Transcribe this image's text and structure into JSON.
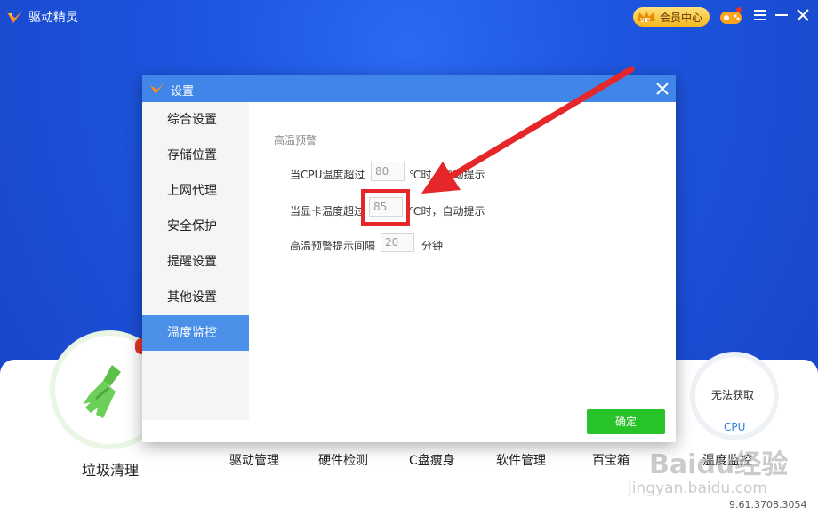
{
  "app": {
    "title": "驱动精灵",
    "vip_label": "会员中心",
    "version": "9.61.3708.3054"
  },
  "main": {
    "clean_label": "垃圾清理",
    "nav": [
      "驱动管理",
      "硬件检测",
      "C盘瘦身",
      "软件管理",
      "百宝箱",
      "温度监控"
    ],
    "cpu_status": "无法获取",
    "cpu_label": "CPU"
  },
  "dialog": {
    "title": "设置",
    "sidebar": [
      "综合设置",
      "存储位置",
      "上网代理",
      "安全保护",
      "提醒设置",
      "其他设置",
      "温度监控"
    ],
    "active_index": 6,
    "section_title": "高温预警",
    "rows": {
      "cpu_label_pre": "当CPU温度超过",
      "cpu_value": "80",
      "cpu_label_post": "℃时，自动提示",
      "gpu_label_pre": "当显卡温度超过",
      "gpu_value": "85",
      "gpu_label_post": "℃时，自动提示",
      "interval_label_pre": "高温预警提示间隔",
      "interval_value": "20",
      "interval_label_post": "分钟"
    },
    "ok_label": "确定"
  },
  "watermark": {
    "brand": "Baidu经验",
    "url": "jingyan.baidu.com"
  },
  "colors": {
    "background": "#1b52d6",
    "dialog_title_bar": "#3f86e8",
    "active_tab": "#4a90e8",
    "ok_button": "#28c328",
    "annotation_red": "#e5272a"
  }
}
